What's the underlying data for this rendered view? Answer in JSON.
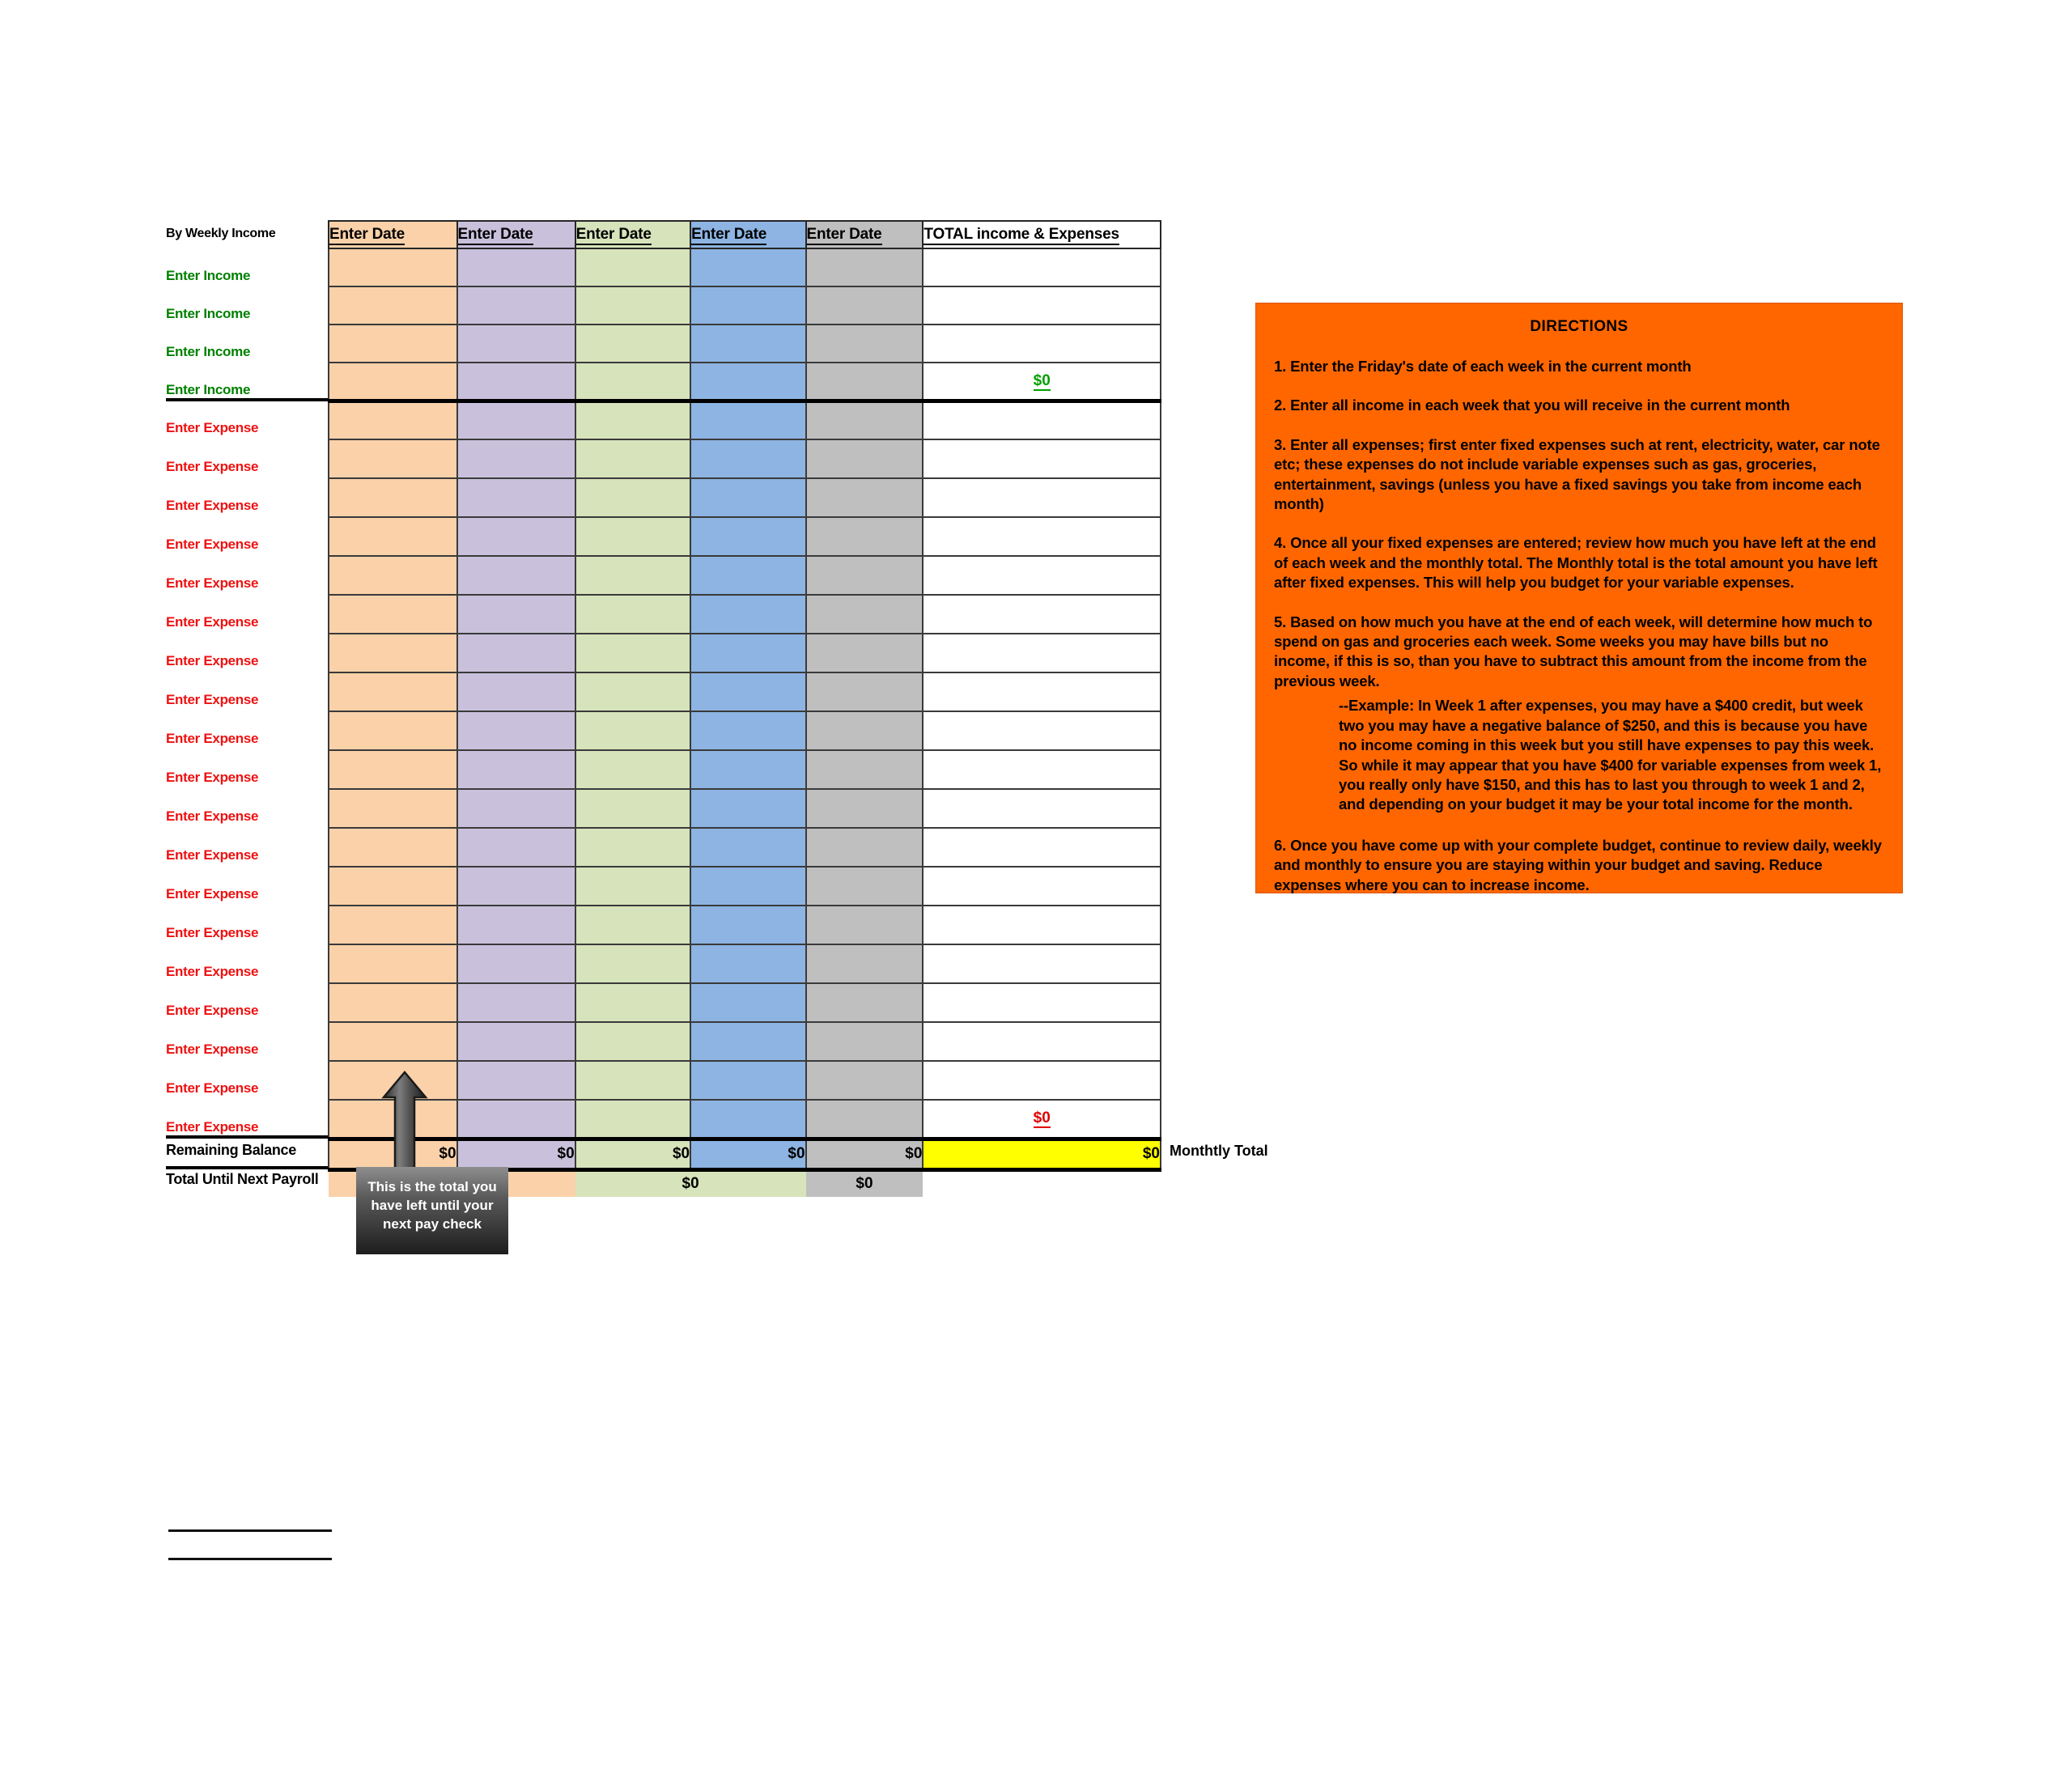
{
  "sheet": {
    "corner_label": "By Weekly Income",
    "column_headers": [
      "Enter Date",
      "Enter Date",
      "Enter Date",
      "Enter Date",
      "Enter Date",
      "TOTAL income & Expenses"
    ],
    "income_row_label": "Enter Income",
    "expense_row_label": "Enter Expense",
    "income_rows": 4,
    "expense_rows": 19,
    "income_total": "$0",
    "expense_total": "$0",
    "remaining_balance_label": "Remaining Balance",
    "remaining_balance_values": [
      "$0",
      "$0",
      "$0",
      "$0",
      "$0"
    ],
    "monthly_total_value": "$0",
    "monthly_total_label": "Monthtly Total",
    "total_until_next_payroll_label": "Total Until Next Payroll",
    "total_until_next_payroll_values": [
      "$0",
      "$0",
      "$0"
    ],
    "colors": {
      "week1": "#fad1a9",
      "week2": "#c9c1dc",
      "week3": "#d7e3bb",
      "week4": "#8db4e2",
      "week5": "#bfbfbf",
      "monthly_total_highlight": "#ffff00",
      "income_text": "#008000",
      "expense_text": "#ee1111"
    }
  },
  "callout": {
    "text": "This is the total you have left until your next pay check",
    "arrow": "up-arrow-icon"
  },
  "directions": {
    "title": "DIRECTIONS",
    "items": [
      "1. Enter the Friday's date of each week in the current month",
      "2. Enter all income in each week that you will receive in the current month",
      "3. Enter all expenses; first enter fixed expenses such at rent, electricity, water, car note etc; these expenses do not include variable expenses such as gas, groceries, entertainment, savings (unless you have a fixed savings you take from income each month)",
      "4. Once all your fixed expenses are entered; review how much you have left at the end of each week and the monthly total. The Monthly total is the total amount you have left after fixed expenses. This will help you budget for your variable expenses.",
      "5. Based on how much you have at the end of each week, will determine how much to spend on gas and groceries each week. Some weeks you may have bills but no income, if this is so, than you have to subtract this amount from the income from the previous week.",
      "6. Once you have come up with your complete budget, continue to review daily, weekly and monthly to ensure you are staying within your budget and saving. Reduce expenses where you can to increase income."
    ],
    "sub_example": "--Example: In Week 1 after expenses, you may have a $400 credit, but week two you may have a negative balance of $250, and this is because you have no income coming in this week but you still have expenses to pay this week. So while it may appear that you have $400 for variable expenses from week 1, you really only have $150, and this has to last you through to week 1 and 2, and depending on your budget it may be your total income for the month.",
    "background_color": "#ff6600"
  }
}
